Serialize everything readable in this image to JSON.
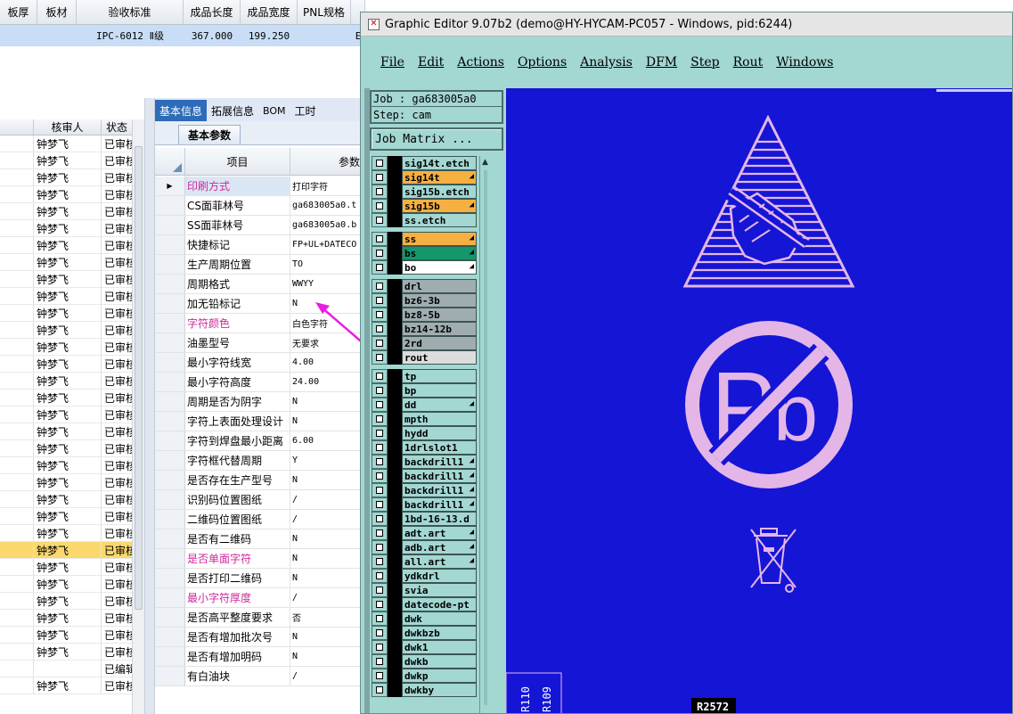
{
  "top_table": {
    "headers": [
      {
        "label": "板厚",
        "w": 42
      },
      {
        "label": "板材",
        "w": 44
      },
      {
        "label": "验收标准",
        "w": 120
      },
      {
        "label": "成品长度",
        "w": 64
      },
      {
        "label": "成品宽度",
        "w": 64
      },
      {
        "label": "PNL规格",
        "w": 60
      },
      {
        "label": "",
        "w": 16
      }
    ],
    "row": [
      "",
      "",
      "IPC-6012 Ⅱ级",
      "367.000",
      "199.250",
      "",
      "E"
    ]
  },
  "left_grid": {
    "headers": [
      "",
      "核审人",
      "状态"
    ],
    "rows": [
      {
        "reviewer": "钟梦飞",
        "status": "已审核"
      },
      {
        "reviewer": "钟梦飞",
        "status": "已审核"
      },
      {
        "reviewer": "钟梦飞",
        "status": "已审核"
      },
      {
        "reviewer": "钟梦飞",
        "status": "已审核"
      },
      {
        "reviewer": "钟梦飞",
        "status": "已审核"
      },
      {
        "reviewer": "钟梦飞",
        "status": "已审核"
      },
      {
        "reviewer": "钟梦飞",
        "status": "已审核"
      },
      {
        "reviewer": "钟梦飞",
        "status": "已审核"
      },
      {
        "reviewer": "钟梦飞",
        "status": "已审核"
      },
      {
        "reviewer": "钟梦飞",
        "status": "已审核"
      },
      {
        "reviewer": "钟梦飞",
        "status": "已审核"
      },
      {
        "reviewer": "钟梦飞",
        "status": "已审核"
      },
      {
        "reviewer": "钟梦飞",
        "status": "已审核"
      },
      {
        "reviewer": "钟梦飞",
        "status": "已审核"
      },
      {
        "reviewer": "钟梦飞",
        "status": "已审核"
      },
      {
        "reviewer": "钟梦飞",
        "status": "已审核"
      },
      {
        "reviewer": "钟梦飞",
        "status": "已审核"
      },
      {
        "reviewer": "钟梦飞",
        "status": "已审核"
      },
      {
        "reviewer": "钟梦飞",
        "status": "已审核"
      },
      {
        "reviewer": "钟梦飞",
        "status": "已审核"
      },
      {
        "reviewer": "钟梦飞",
        "status": "已审核"
      },
      {
        "reviewer": "钟梦飞",
        "status": "已审核"
      },
      {
        "reviewer": "钟梦飞",
        "status": "已审核"
      },
      {
        "reviewer": "钟梦飞",
        "status": "已审核"
      },
      {
        "reviewer": "钟梦飞",
        "status": "已审核",
        "selected": true
      },
      {
        "reviewer": "钟梦飞",
        "status": "已审核"
      },
      {
        "reviewer": "钟梦飞",
        "status": "已审核"
      },
      {
        "reviewer": "钟梦飞",
        "status": "已审核"
      },
      {
        "reviewer": "钟梦飞",
        "status": "已审核"
      },
      {
        "reviewer": "钟梦飞",
        "status": "已审核"
      },
      {
        "reviewer": "钟梦飞",
        "status": "已审核"
      },
      {
        "reviewer": "",
        "status": "已编辑"
      },
      {
        "reviewer": "钟梦飞",
        "status": "已审核"
      }
    ]
  },
  "tabs": [
    "基本信息",
    "拓展信息",
    "BOM",
    "工时"
  ],
  "subtab": "基本参数",
  "prop_grid": {
    "headers": [
      "项目",
      "参数"
    ],
    "rows": [
      {
        "name": "印刷方式",
        "value": "打印字符",
        "pink": true,
        "first": true
      },
      {
        "name": "CS面菲林号",
        "value": "ga683005a0.t"
      },
      {
        "name": "SS面菲林号",
        "value": "ga683005a0.b"
      },
      {
        "name": "快捷标记",
        "value": "FP+UL+DATECO"
      },
      {
        "name": "生产周期位置",
        "value": "TO"
      },
      {
        "name": "周期格式",
        "value": "WWYY"
      },
      {
        "name": "加无铅标记",
        "value": "N"
      },
      {
        "name": "字符颜色",
        "value": "白色字符",
        "pink": true
      },
      {
        "name": "油墨型号",
        "value": "无要求"
      },
      {
        "name": "最小字符线宽",
        "value": "4.00"
      },
      {
        "name": "最小字符高度",
        "value": "24.00"
      },
      {
        "name": "周期是否为阴字",
        "value": "N"
      },
      {
        "name": "字符上表面处理设计",
        "value": "N"
      },
      {
        "name": "字符到焊盘最小距离",
        "value": "6.00"
      },
      {
        "name": "字符框代替周期",
        "value": "Y"
      },
      {
        "name": "是否存在生产型号",
        "value": "N"
      },
      {
        "name": "识别码位置图纸",
        "value": "/"
      },
      {
        "name": "二维码位置图纸",
        "value": "/"
      },
      {
        "name": "是否有二维码",
        "value": "N"
      },
      {
        "name": "是否单面字符",
        "value": "N",
        "pink": true
      },
      {
        "name": "是否打印二维码",
        "value": "N"
      },
      {
        "name": "最小字符厚度",
        "value": "/",
        "pink": true
      },
      {
        "name": "是否高平整度要求",
        "value": "否"
      },
      {
        "name": "是否有增加批次号",
        "value": "N"
      },
      {
        "name": "是否有增加明码",
        "value": "N"
      },
      {
        "name": "有白油块",
        "value": "/"
      }
    ]
  },
  "ge": {
    "title": "Graphic Editor 9.07b2 (demo@HY-HYCAM-PC057 - Windows, pid:6244)",
    "menu": [
      "File",
      "Edit",
      "Actions",
      "Options",
      "Analysis",
      "DFM",
      "Step",
      "Rout",
      "Windows"
    ],
    "job": "Job : ga683005a0",
    "step": "Step: cam",
    "matrix_button": "Job Matrix ...",
    "layers": [
      {
        "name": "sig14t.etch",
        "color": "#a3d7d2"
      },
      {
        "name": "sig14t",
        "color": "#f6b042",
        "flag": true
      },
      {
        "name": "sig15b.etch",
        "color": "#a3d7d2"
      },
      {
        "name": "sig15b",
        "color": "#f6b042",
        "flag": true
      },
      {
        "name": "ss.etch",
        "color": "#a3d7d2",
        "gap_after": true
      },
      {
        "name": "ss",
        "color": "#f6b042",
        "flag": true
      },
      {
        "name": "bs",
        "color": "#14976b",
        "flag": true
      },
      {
        "name": "bo",
        "color": "#ffffff",
        "flag": true,
        "gap_after": true
      },
      {
        "name": "drl",
        "color": "#9fadb0"
      },
      {
        "name": "bz6-3b",
        "color": "#9fadb0"
      },
      {
        "name": "bz8-5b",
        "color": "#9fadb0"
      },
      {
        "name": "bz14-12b",
        "color": "#9fadb0"
      },
      {
        "name": "2rd",
        "color": "#9fadb0"
      },
      {
        "name": "rout",
        "color": "#dcdcdc",
        "gap_after": true
      },
      {
        "name": "tp",
        "color": "#a3d7d2"
      },
      {
        "name": "bp",
        "color": "#a3d7d2"
      },
      {
        "name": "dd",
        "color": "#a3d7d2",
        "flag": true
      },
      {
        "name": "mpth",
        "color": "#a3d7d2"
      },
      {
        "name": "hydd",
        "color": "#a3d7d2"
      },
      {
        "name": "1drlslot1",
        "color": "#a3d7d2"
      },
      {
        "name": "backdrill1",
        "color": "#a3d7d2",
        "flag": true
      },
      {
        "name": "backdrill1",
        "color": "#a3d7d2",
        "flag": true
      },
      {
        "name": "backdrill1",
        "color": "#a3d7d2",
        "flag": true
      },
      {
        "name": "backdrill1",
        "color": "#a3d7d2",
        "flag": true
      },
      {
        "name": "1bd-16-13.d",
        "color": "#a3d7d2"
      },
      {
        "name": "adt.art",
        "color": "#a3d7d2",
        "flag": true
      },
      {
        "name": "adb.art",
        "color": "#a3d7d2",
        "flag": true
      },
      {
        "name": "all.art",
        "color": "#a3d7d2",
        "flag": true
      },
      {
        "name": "ydkdrl",
        "color": "#a3d7d2"
      },
      {
        "name": "svia",
        "color": "#a3d7d2"
      },
      {
        "name": "datecode-pt",
        "color": "#a3d7d2"
      },
      {
        "name": "dwk",
        "color": "#a3d7d2"
      },
      {
        "name": "dwkbzb",
        "color": "#a3d7d2"
      },
      {
        "name": "dwk1",
        "color": "#a3d7d2"
      },
      {
        "name": "dwkb",
        "color": "#a3d7d2"
      },
      {
        "name": "dwkp",
        "color": "#a3d7d2"
      },
      {
        "name": "dwkby",
        "color": "#a3d7d2"
      }
    ],
    "canvas": {
      "labels": [
        "R110",
        "R109",
        "R2572"
      ],
      "symbol_color": "#e4b6e8",
      "background": "#1515d6"
    }
  },
  "colors": {
    "accent_tab": "#2e6bb8",
    "pink_label": "#d0279c",
    "annotation_arrow": "#e81de0",
    "selected_row": "#fbd86d"
  }
}
